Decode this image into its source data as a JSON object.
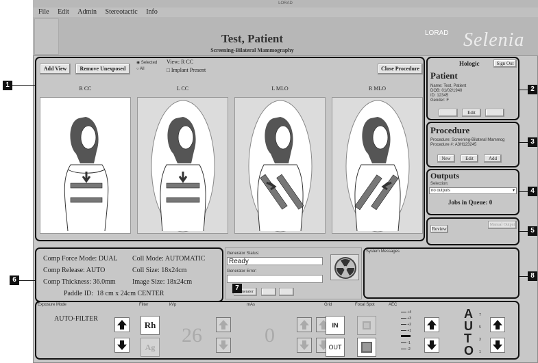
{
  "window": {
    "title": "LORAD"
  },
  "menu": [
    "File",
    "Edit",
    "Admin",
    "Stereotactic",
    "Info"
  ],
  "header": {
    "patient_name": "Test, Patient",
    "procedure": "Screening-Bilateral Mammography",
    "logo_small": "LORAD",
    "logo_large": "Selenia"
  },
  "toolbar": {
    "add_view": "Add View",
    "remove_unexposed": "Remove Unexposed",
    "radio_selected": "Selected",
    "radio_all": "All",
    "view_label": "View:",
    "view_value": "R CC",
    "implant_label": "Implant Present",
    "close_procedure": "Close Procedure"
  },
  "views": [
    {
      "label": "R CC",
      "selected": true
    },
    {
      "label": "L CC",
      "selected": false
    },
    {
      "label": "L MLO",
      "selected": false
    },
    {
      "label": "R MLO",
      "selected": false
    }
  ],
  "user": {
    "org": "Hologic",
    "sign_out": "Sign Out"
  },
  "patient": {
    "title": "Patient",
    "name_label": "Name:",
    "name": "Test, Patient",
    "dob_label": "DOB:",
    "dob": "01/02/1940",
    "id_label": "ID:",
    "id": "12345",
    "gender_label": "Gender:",
    "gender": "F",
    "btn1": "",
    "btn_edit": "Edit",
    "btn3": ""
  },
  "procedure": {
    "title": "Procedure",
    "proc_label": "Procedure:",
    "proc_value": "Screening-Bilateral Mammog",
    "num_label": "Procedure #:",
    "num_value": "A3H123245",
    "btn_new": "New",
    "btn_edit": "Edit",
    "btn_add": "Add"
  },
  "outputs": {
    "title": "Outputs",
    "selection_label": "Selection:",
    "selection_value": "no outputs",
    "jobs": "Jobs in Queue: 0"
  },
  "review": {
    "review": "Review",
    "second": "Manual Output"
  },
  "exposure": {
    "comp_force_mode_label": "Comp Force Mode:",
    "comp_force_mode": "DUAL",
    "coll_mode_label": "Coll Mode:",
    "coll_mode": "AUTOMATIC",
    "comp_release_label": "Comp Release:",
    "comp_release": "AUTO",
    "coll_size_label": "Coll Size:",
    "coll_size": "18x24cm",
    "comp_thickness_label": "Comp Thickness:",
    "comp_thickness": "36.0mm",
    "image_size_label": "Image Size:",
    "image_size": "18x24cm",
    "paddle": "Paddle ID:  18 cm x 24cm CENTER"
  },
  "generator": {
    "status_label": "Generator Status:",
    "status": "Ready",
    "error_label": "Generator Error:",
    "error": "",
    "btn_generator": "Generator",
    "btn_b": "",
    "btn_c": ""
  },
  "messages": {
    "label": "System Messages"
  },
  "controls": {
    "exposure_mode_label": "Exposure Mode",
    "exposure_mode": "AUTO-FILTER",
    "filter_label": "Filter",
    "filter_a": "Rh",
    "filter_b": "Ag",
    "kvp_label": "kVp",
    "kvp": "26",
    "mas_label": "mAs",
    "mas": "0",
    "grid_label": "Grid",
    "grid_in": "IN",
    "grid_out": "OUT",
    "focal_spot_label": "Focal Spot",
    "aec_label": "AEC",
    "aec_scale": [
      "+4",
      "+3",
      "+2",
      "+1",
      "",
      "-1",
      "-2"
    ],
    "auto_letters": [
      "A",
      "U",
      "T",
      "O"
    ],
    "auto_numbers": [
      "7",
      "5",
      "3",
      "1"
    ]
  },
  "callouts": [
    "1",
    "2",
    "3",
    "4",
    "5",
    "6",
    "7",
    "8"
  ]
}
